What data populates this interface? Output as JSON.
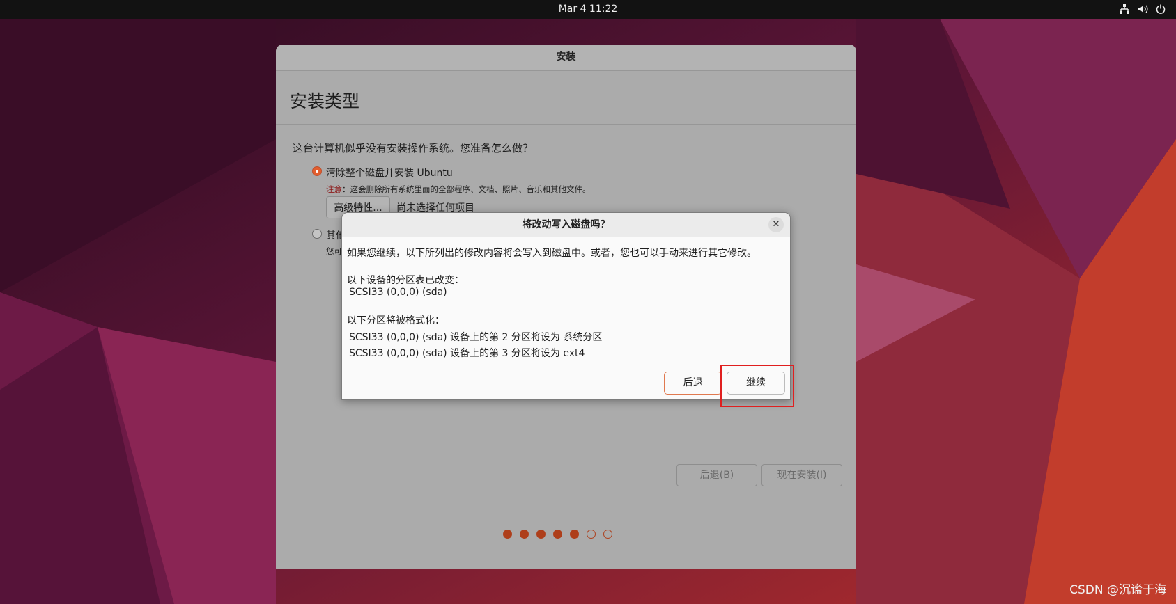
{
  "topbar": {
    "clock": "Mar 4  11:22",
    "tray_icons": [
      "network-icon",
      "volume-icon",
      "power-icon"
    ]
  },
  "installer": {
    "window_title": "安装",
    "page_title": "安装类型",
    "question": "这台计算机似乎没有安装操作系统。您准备怎么做？",
    "option_erase": "清除整个磁盘并安装 Ubuntu",
    "warning_label": "注意",
    "warning_text": "：这会删除所有系统里面的全部程序、文档、照片、音乐和其他文件。",
    "advanced_button": "高级特性...",
    "advanced_status": "尚未选择任何项目",
    "option_other": "其他",
    "option_other_desc": "您可",
    "back_button": "后退(B)",
    "install_button": "现在安装(I)",
    "progress": {
      "total_steps": 7,
      "completed_steps": 5
    }
  },
  "dialog": {
    "title": "将改动写入磁盘吗？",
    "intro": "如果您继续，以下所列出的修改内容将会写入到磁盘中。或者，您也可以手动来进行其它修改。",
    "partition_table_heading": "以下设备的分区表已改变：",
    "partition_table_device": "SCSI33 (0,0,0) (sda)",
    "format_heading": "以下分区将被格式化：",
    "format_line_1": "SCSI33 (0,0,0) (sda) 设备上的第 2 分区将设为 系统分区",
    "format_line_2": "SCSI33 (0,0,0) (sda) 设备上的第 3 分区将设为 ext4",
    "back_button": "后退",
    "continue_button": "继续"
  },
  "colors": {
    "accent": "#e95420",
    "highlight": "#e01f1f"
  },
  "watermark": "CSDN @沉谧于海"
}
